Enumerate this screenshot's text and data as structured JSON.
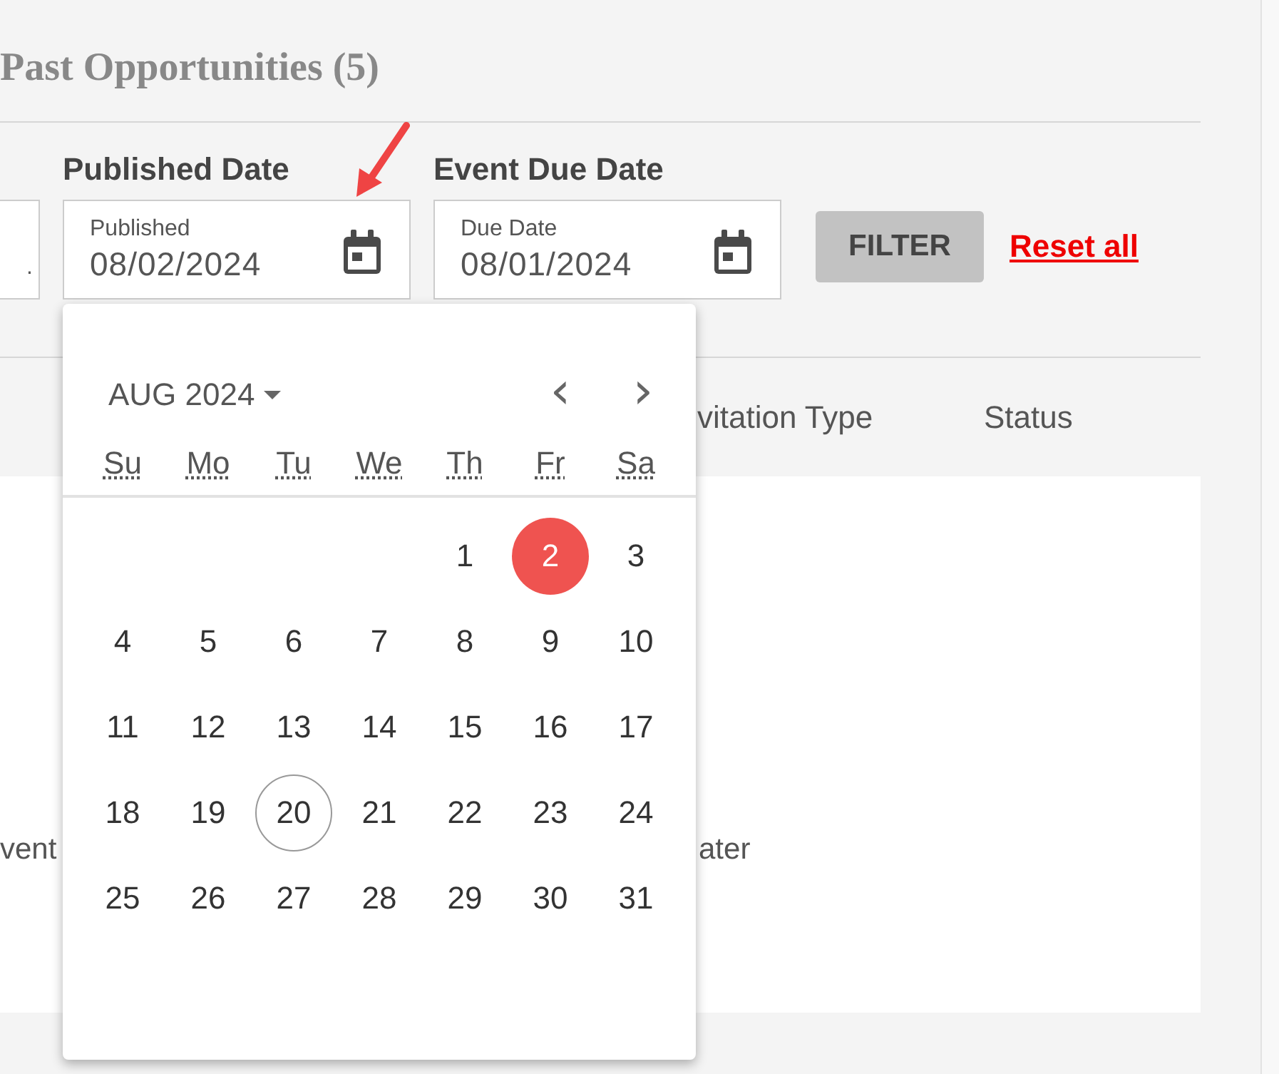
{
  "heading": "Past Opportunities (5)",
  "filters": {
    "partial_field": {
      "value": "."
    },
    "fields": [
      {
        "label": "Published Date",
        "placeholder": "Published",
        "value": "08/02/2024"
      },
      {
        "label": "Event Due Date",
        "placeholder": "Due Date",
        "value": "08/01/2024"
      }
    ],
    "filter_button": "FILTER",
    "reset_link": "Reset all"
  },
  "table": {
    "columns": [
      "vitation Type",
      "Status"
    ]
  },
  "empty_state": {
    "line_start": "vent",
    "line_end": "ater"
  },
  "datepicker": {
    "month": "AUG 2024",
    "prev": "‹",
    "next": "›",
    "weekdays": [
      "Su",
      "Mo",
      "Tu",
      "We",
      "Th",
      "Fr",
      "Sa"
    ],
    "weeks": [
      {
        "kind": "first",
        "days": [
          {
            "label": "1",
            "selected": false,
            "today": false
          },
          {
            "label": "2",
            "selected": true,
            "today": false
          },
          {
            "label": "3",
            "selected": false,
            "today": false
          }
        ]
      },
      {
        "kind": "full",
        "days": [
          {
            "label": "4",
            "selected": false,
            "today": false
          },
          {
            "label": "5",
            "selected": false,
            "today": false
          },
          {
            "label": "6",
            "selected": false,
            "today": false
          },
          {
            "label": "7",
            "selected": false,
            "today": false
          },
          {
            "label": "8",
            "selected": false,
            "today": false
          },
          {
            "label": "9",
            "selected": false,
            "today": false
          },
          {
            "label": "10",
            "selected": false,
            "today": false
          }
        ]
      },
      {
        "kind": "full",
        "days": [
          {
            "label": "11",
            "selected": false,
            "today": false
          },
          {
            "label": "12",
            "selected": false,
            "today": false
          },
          {
            "label": "13",
            "selected": false,
            "today": false
          },
          {
            "label": "14",
            "selected": false,
            "today": false
          },
          {
            "label": "15",
            "selected": false,
            "today": false
          },
          {
            "label": "16",
            "selected": false,
            "today": false
          },
          {
            "label": "17",
            "selected": false,
            "today": false
          }
        ]
      },
      {
        "kind": "full",
        "days": [
          {
            "label": "18",
            "selected": false,
            "today": false
          },
          {
            "label": "19",
            "selected": false,
            "today": false
          },
          {
            "label": "20",
            "selected": false,
            "today": true
          },
          {
            "label": "21",
            "selected": false,
            "today": false
          },
          {
            "label": "22",
            "selected": false,
            "today": false
          },
          {
            "label": "23",
            "selected": false,
            "today": false
          },
          {
            "label": "24",
            "selected": false,
            "today": false
          }
        ]
      },
      {
        "kind": "full",
        "days": [
          {
            "label": "25",
            "selected": false,
            "today": false
          },
          {
            "label": "26",
            "selected": false,
            "today": false
          },
          {
            "label": "27",
            "selected": false,
            "today": false
          },
          {
            "label": "28",
            "selected": false,
            "today": false
          },
          {
            "label": "29",
            "selected": false,
            "today": false
          },
          {
            "label": "30",
            "selected": false,
            "today": false
          },
          {
            "label": "31",
            "selected": false,
            "today": false
          }
        ]
      }
    ]
  }
}
